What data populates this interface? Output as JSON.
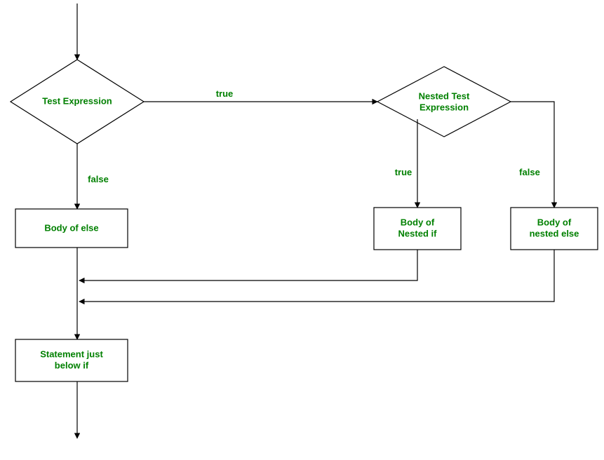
{
  "diagram": {
    "nodes": {
      "test_expression": "Test Expression",
      "nested_test_line1": "Nested Test",
      "nested_test_line2": "Expression",
      "body_else": "Body of else",
      "body_nested_if_line1": "Body of",
      "body_nested_if_line2": "Nested if",
      "body_nested_else_line1": "Body of",
      "body_nested_else_line2": "nested else",
      "statement_line1": "Statement just",
      "statement_line2": "below if"
    },
    "edges": {
      "true1": "true",
      "false1": "false",
      "true2": "true",
      "false2": "false"
    }
  }
}
